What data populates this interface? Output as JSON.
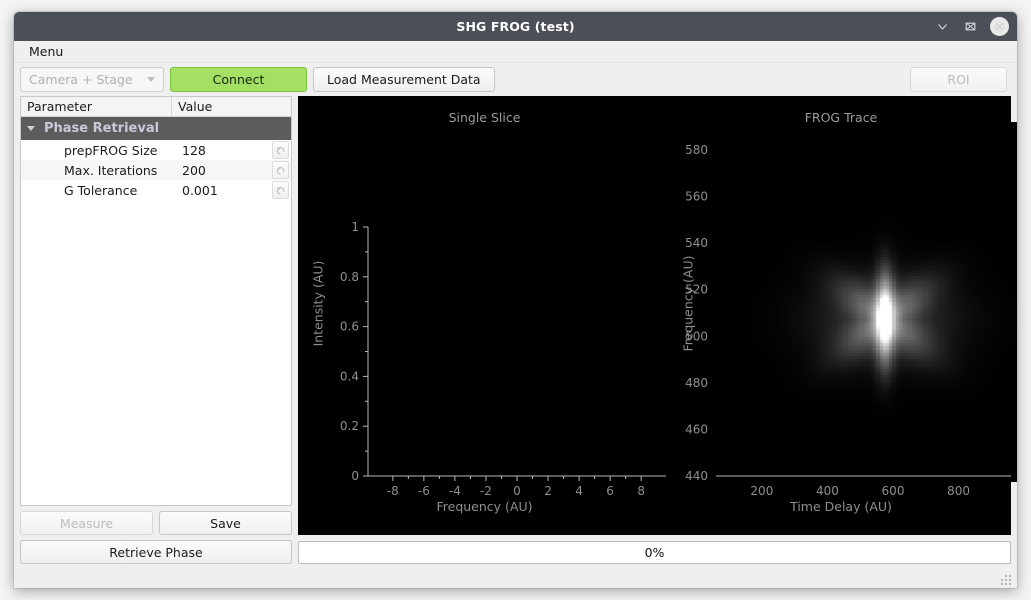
{
  "window": {
    "title": "SHG FROG (test)",
    "controls": {
      "minimize": "minimize-icon",
      "maximize": "maximize-icon",
      "close": "close-icon"
    }
  },
  "menubar": {
    "items": [
      {
        "label": "Menu"
      }
    ]
  },
  "toolbar": {
    "device_combo": {
      "value": "Camera + Stage",
      "enabled": false,
      "caret": "chevron-down-icon"
    },
    "connect_label": "Connect",
    "connect_color": "#a4e063",
    "load_label": "Load Measurement Data",
    "roi_label": "ROI",
    "roi_enabled": false
  },
  "tree": {
    "columns": [
      "Parameter",
      "Value"
    ],
    "group": {
      "label": "Phase Retrieval",
      "expanded": true,
      "caret": "caret-down-icon"
    },
    "rows": [
      {
        "name": "prepFROG Size",
        "value": "128",
        "reset": "reset-icon"
      },
      {
        "name": "Max. Iterations",
        "value": "200",
        "reset": "reset-icon"
      },
      {
        "name": "G Tolerance",
        "value": "0.001",
        "reset": "reset-icon"
      }
    ]
  },
  "actions": {
    "measure_label": "Measure",
    "measure_enabled": false,
    "save_label": "Save",
    "retrieve_label": "Retrieve Phase"
  },
  "progress": {
    "text": "0%",
    "percent": 0
  },
  "chart_data": [
    {
      "type": "line",
      "title": "Single Slice",
      "xlabel": "Frequency (AU)",
      "ylabel": "Intensity (AU)",
      "xlim": [
        -9.6,
        9.6
      ],
      "ylim": [
        0,
        1
      ],
      "xticks": [
        "-8",
        "-6",
        "-4",
        "-2",
        "0",
        "2",
        "4",
        "6",
        "8"
      ],
      "xtick_values": [
        -8,
        -6,
        -4,
        -2,
        0,
        2,
        4,
        6,
        8
      ],
      "yticks": [
        "0",
        "0.2",
        "0.4",
        "0.6",
        "0.8",
        "1"
      ],
      "ytick_values": [
        0,
        0.2,
        0.4,
        0.6,
        0.8,
        1
      ],
      "minor_ticks": true,
      "grid": false,
      "series": [],
      "background": "#000000",
      "axis_color": "#b9b9b9",
      "note": "empty plot - no data plotted"
    },
    {
      "type": "heatmap",
      "title": "FROG Trace",
      "xlabel": "Time Delay (AU)",
      "ylabel": "Frequency (AU)",
      "xlim": [
        60,
        960
      ],
      "ylim": [
        440,
        592
      ],
      "xticks": [
        "200",
        "400",
        "600",
        "800"
      ],
      "xtick_values": [
        200,
        400,
        600,
        800
      ],
      "yticks": [
        "440",
        "460",
        "480",
        "500",
        "520",
        "540",
        "560",
        "580"
      ],
      "ytick_values": [
        440,
        460,
        480,
        500,
        520,
        540,
        560,
        580
      ],
      "colormap": "gray",
      "grid": false,
      "background": "#000000",
      "axis_color": "#b9b9b9",
      "peak": {
        "time_delay": 520,
        "frequency": 509,
        "intensity": 1.0
      },
      "features": [
        "bright vertical core centered near time delay 520, frequency 509",
        "horizontal side lobes extending left and right at frequency ~509",
        "bowtie-shaped diagonal wings above and below the core"
      ]
    }
  ]
}
